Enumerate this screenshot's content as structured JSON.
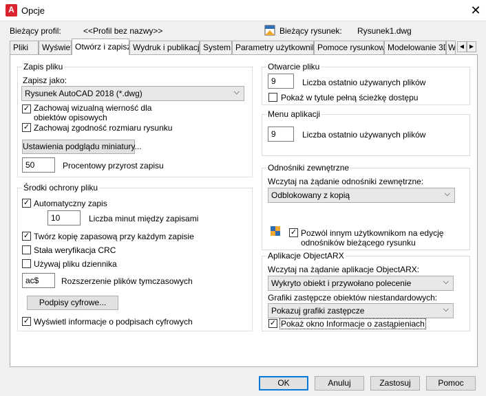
{
  "window": {
    "title": "Opcje",
    "app_icon": "A",
    "close": "✕"
  },
  "profile": {
    "label": "Bieżący profil:",
    "value": "<<Profil bez nazwy>>"
  },
  "drawing": {
    "label": "Bieżący rysunek:",
    "value": "Rysunek1.dwg"
  },
  "tabs": [
    "Pliki",
    "Wyświetl",
    "Otwórz i zapisz",
    "Wydruk i publikacja",
    "System",
    "Parametry użytkownika",
    "Pomoce rysunkowe",
    "Modelowanie 3D",
    "W"
  ],
  "tab_arrows": {
    "left": "◀",
    "right": "▶"
  },
  "save": {
    "group": "Zapis pliku",
    "save_as_label": "Zapisz jako:",
    "save_as_value": "Rysunek AutoCAD 2018 (*.dwg)",
    "keep_visual_1": "Zachowaj wizualną wierność dla",
    "keep_visual_2": "obiektów opisowych",
    "keep_size": "Zachowaj zgodność rozmiaru rysunku",
    "thumb_button": "Ustawienia podglądu miniatury...",
    "increment_value": "50",
    "increment_label": "Procentowy przyrost zapisu"
  },
  "safety": {
    "group": "Środki ochrony pliku",
    "autosave": "Automatyczny zapis",
    "minutes_value": "10",
    "minutes_label": "Liczba minut między zapisami",
    "backup": "Twórz kopię zapasową przy każdym zapisie",
    "crc": "Stała weryfikacja CRC",
    "log": "Używaj pliku dziennika",
    "ext_value": "ac$",
    "ext_label": "Rozszerzenie plików tymczasowych",
    "signatures_button": "Podpisy cyfrowe...",
    "show_sig": "Wyświetl informacje o podpisach cyfrowych"
  },
  "open": {
    "group": "Otwarcie pliku",
    "recent_value": "9",
    "recent_label": "Liczba ostatnio używanych plików",
    "fullpath": "Pokaż w tytule pełną ścieżkę dostępu"
  },
  "appmenu": {
    "group": "Menu aplikacji",
    "recent_value": "9",
    "recent_label": "Liczba ostatnio używanych plików"
  },
  "xref": {
    "group": "Odnośniki zewnętrzne",
    "demand_label": "Wczytaj na żądanie odnośniki zewnętrzne:",
    "demand_value": "Odblokowany z kopią",
    "allow_1": "Pozwól innym użytkownikom na edycję",
    "allow_2": "odnośników bieżącego rysunku"
  },
  "arx": {
    "group": "Aplikacje ObjectARX",
    "demand_label": "Wczytaj na żądanie aplikacje ObjectARX:",
    "demand_value": "Wykryto obiekt i przywołano polecenie",
    "proxy_label": "Grafiki zastępcze obiektów niestandardowych:",
    "proxy_value": "Pokazuj grafiki zastępcze",
    "proxy_info": "Pokaż okno Informacje o zastąpieniach"
  },
  "buttons": {
    "ok": "OK",
    "cancel": "Anuluj",
    "apply": "Zastosuj",
    "help": "Pomoc"
  },
  "glyphs": {
    "check": "✓",
    "chevron": "⌵"
  }
}
